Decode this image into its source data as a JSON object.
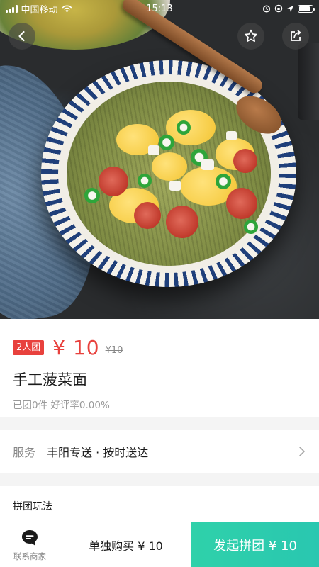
{
  "status_bar": {
    "carrier": "中国移动",
    "time": "15:13",
    "battery_level": 0.85
  },
  "header": {
    "back_icon": "chevron-left-icon",
    "favorite_icon": "star-icon",
    "share_icon": "share-icon"
  },
  "product": {
    "group_tag": "2人团",
    "price": "¥ 10",
    "original_price": "¥10",
    "title": "手工菠菜面",
    "stats": "已团0件 好评率0.00%"
  },
  "service": {
    "label": "服务",
    "value": "丰阳专送 · 按时送达",
    "arrow_icon": "chevron-right-icon"
  },
  "play_section": {
    "title": "拼团玩法"
  },
  "bottom_bar": {
    "contact_icon": "chat-bubble-icon",
    "contact_label": "联系商家",
    "solo_buy_label": "单独购买 ¥ 10",
    "group_buy_label": "发起拼团 ¥ 10"
  },
  "colors": {
    "accent_red": "#e8413d",
    "group_button": "#2fd1aa"
  }
}
